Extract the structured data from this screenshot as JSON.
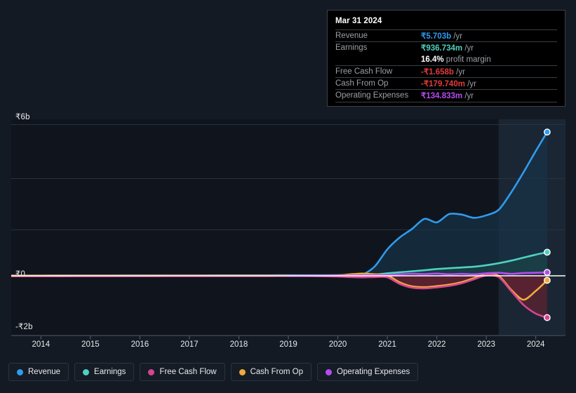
{
  "theme": {
    "background": "#141a23",
    "plot_background": "#10151d",
    "highlight_band": "#18222e",
    "grid": "#2a313c",
    "zero_axis": "#ffffff",
    "text": "#e8eaed",
    "muted_text": "#9aa0a6"
  },
  "tooltip": {
    "date": "Mar 31 2024",
    "rows": [
      {
        "label": "Revenue",
        "amount": "₹5.703b",
        "unit": "/yr",
        "color": "#2e9bef"
      },
      {
        "label": "Earnings",
        "amount": "₹936.734m",
        "unit": "/yr",
        "color": "#4fd1c0"
      },
      {
        "label": "Free Cash Flow",
        "amount": "-₹1.658b",
        "unit": "/yr",
        "color": "#e23b3b"
      },
      {
        "label": "Cash From Op",
        "amount": "-₹179.740m",
        "unit": "/yr",
        "color": "#e23b3b"
      },
      {
        "label": "Operating Expenses",
        "amount": "₹134.833m",
        "unit": "/yr",
        "color": "#b44df0"
      }
    ],
    "profit_margin": {
      "value": "16.4%",
      "text": "profit margin"
    }
  },
  "legend": {
    "items": [
      {
        "label": "Revenue",
        "color": "#2e9bef"
      },
      {
        "label": "Earnings",
        "color": "#4fd1c0"
      },
      {
        "label": "Free Cash Flow",
        "color": "#d6458f"
      },
      {
        "label": "Cash From Op",
        "color": "#f0a93c"
      },
      {
        "label": "Operating Expenses",
        "color": "#b44df0"
      }
    ]
  },
  "chart_data": {
    "type": "line",
    "title": "",
    "xlabel": "",
    "ylabel": "",
    "currency": "₹ (INR)",
    "grid": true,
    "legend_position": "bottom",
    "x_tick_labels": [
      "2014",
      "2015",
      "2016",
      "2017",
      "2018",
      "2019",
      "2020",
      "2021",
      "2022",
      "2023",
      "2024"
    ],
    "y_tick_labels": [
      "₹6b",
      "₹0",
      "-₹2b"
    ],
    "ylim": [
      -2.0,
      6.0
    ],
    "y_unit": "billions INR",
    "xlim": [
      "2013.4",
      "2024.6"
    ],
    "highlight_band_start": "2023.25",
    "x": [
      2013.4,
      2014,
      2014.5,
      2015,
      2015.5,
      2016,
      2016.5,
      2017,
      2017.5,
      2018,
      2018.5,
      2019,
      2019.5,
      2020,
      2020.25,
      2020.5,
      2020.75,
      2021,
      2021.25,
      2021.5,
      2021.75,
      2022,
      2022.25,
      2022.5,
      2022.75,
      2023,
      2023.25,
      2023.5,
      2023.75,
      2024,
      2024.23
    ],
    "series": [
      {
        "name": "Revenue",
        "color": "#2e9bef",
        "fill": "#16354c",
        "end_value": 5.703,
        "values": [
          0.01,
          0.01,
          0.012,
          0.013,
          0.014,
          0.015,
          0.016,
          0.017,
          0.018,
          0.02,
          0.021,
          0.022,
          0.023,
          0.025,
          0.03,
          0.05,
          0.38,
          1.05,
          1.52,
          1.86,
          2.26,
          2.12,
          2.45,
          2.43,
          2.3,
          2.4,
          2.62,
          3.3,
          4.1,
          4.95,
          5.703
        ]
      },
      {
        "name": "Earnings",
        "color": "#4fd1c0",
        "fill": "#1d4a49",
        "end_value": 0.936734,
        "values": [
          -0.005,
          -0.005,
          -0.004,
          -0.004,
          -0.003,
          -0.003,
          -0.002,
          -0.002,
          -0.001,
          0.0,
          0.001,
          0.002,
          0.003,
          0.004,
          0.006,
          0.01,
          0.05,
          0.1,
          0.14,
          0.18,
          0.22,
          0.27,
          0.3,
          0.33,
          0.36,
          0.42,
          0.5,
          0.6,
          0.72,
          0.84,
          0.936734
        ]
      },
      {
        "name": "Free Cash Flow",
        "color": "#d6458f",
        "fill": "#5e2230",
        "end_value": -1.658,
        "values": [
          -0.02,
          -0.02,
          -0.018,
          -0.017,
          -0.016,
          -0.015,
          -0.014,
          -0.013,
          -0.012,
          -0.012,
          -0.011,
          -0.01,
          -0.012,
          -0.03,
          -0.05,
          -0.06,
          -0.05,
          -0.06,
          -0.32,
          -0.47,
          -0.5,
          -0.46,
          -0.4,
          -0.3,
          -0.14,
          0.02,
          -0.05,
          -0.6,
          -1.15,
          -1.5,
          -1.658
        ]
      },
      {
        "name": "Cash From Op",
        "color": "#f0a93c",
        "fill": "#5e2230",
        "end_value": -0.17974,
        "values": [
          0.004,
          0.004,
          0.004,
          0.004,
          0.004,
          0.004,
          0.004,
          0.004,
          0.004,
          0.004,
          0.004,
          0.004,
          0.006,
          0.02,
          0.06,
          0.09,
          0.06,
          0.02,
          -0.26,
          -0.42,
          -0.45,
          -0.41,
          -0.35,
          -0.25,
          -0.09,
          0.07,
          0.0,
          -0.55,
          -0.95,
          -0.6,
          -0.17974
        ]
      },
      {
        "name": "Operating Expenses",
        "color": "#b44df0",
        "fill": "#3a2150",
        "end_value": 0.134833,
        "values": [
          null,
          null,
          null,
          null,
          null,
          null,
          null,
          null,
          null,
          null,
          null,
          -0.005,
          0.0,
          0.005,
          0.01,
          0.015,
          0.02,
          0.03,
          0.06,
          0.08,
          0.07,
          0.09,
          0.06,
          0.08,
          0.06,
          0.1,
          0.12,
          0.08,
          0.11,
          0.12,
          0.134833
        ]
      }
    ]
  }
}
